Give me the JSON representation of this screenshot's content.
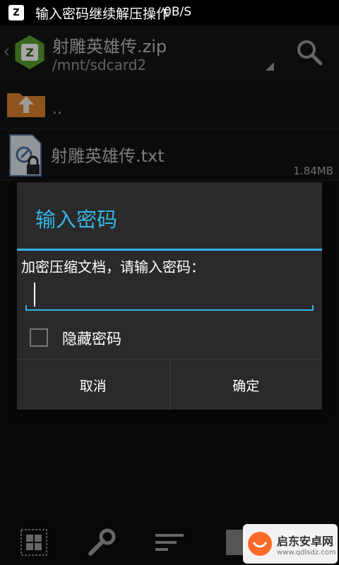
{
  "status_bar": {
    "title": "输入密码继续解压操作",
    "speed": "0B/S",
    "app_icon_glyph": "Z"
  },
  "header": {
    "archive_name": "射雕英雄传.zip",
    "path": "/mnt/sdcard2",
    "app_icon_glyph": "Z"
  },
  "file_list": {
    "parent_label": "..",
    "items": [
      {
        "name": "射雕英雄传.txt",
        "size": "1.84MB"
      }
    ]
  },
  "dialog": {
    "title": "输入密码",
    "prompt": "加密压缩文档，请输入密码：",
    "password_value": "",
    "hide_password_label": "隐藏密码",
    "hide_password_checked": false,
    "cancel_label": "取消",
    "confirm_label": "确定"
  },
  "toolbar": {
    "icons": [
      "grid-icon",
      "wrench-icon",
      "sort-icon",
      "document-icon",
      "list-icon"
    ]
  },
  "watermark": {
    "main": "启东安卓网",
    "sub": "www.qdlsdz.com"
  },
  "colors": {
    "accent": "#33b5e5",
    "app_green": "#5a9e2f",
    "folder_orange": "#d9822b"
  }
}
